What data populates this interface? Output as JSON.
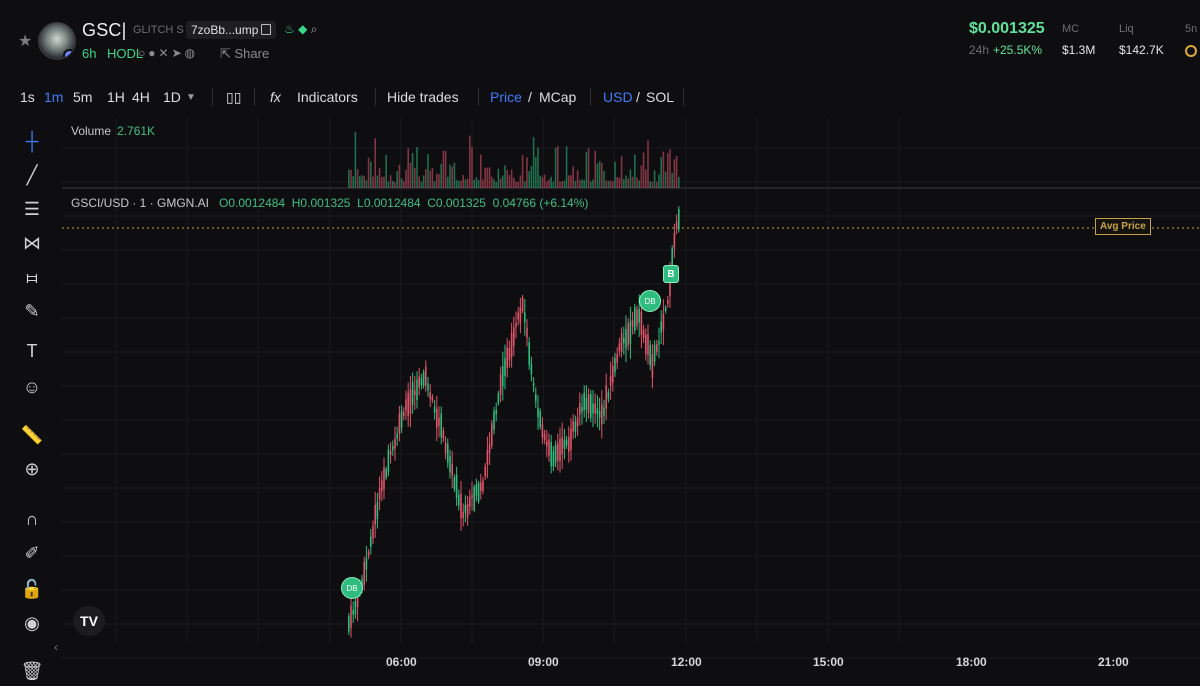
{
  "header": {
    "symbol": "GSC|",
    "name": "GLITCH S",
    "address": "7zoBb...ump",
    "age": "6h",
    "hodl": "HODL",
    "share": "Share",
    "price": "$0.001325",
    "change_label": "24h",
    "change": "+25.5K%",
    "mc_label": "MC",
    "mc_value": "$1.3M",
    "liq_label": "Liq",
    "liq_value": "$142.7K",
    "extra_label": "5n"
  },
  "toolbar": {
    "intervals": [
      "1s",
      "1m",
      "5m",
      "1H",
      "4H",
      "1D"
    ],
    "active_interval": "1m",
    "indicators": "Indicators",
    "hide_trades": "Hide trades",
    "price": "Price",
    "slash1": "/",
    "mcap": "MCap",
    "usd": "USD",
    "slash2": "/",
    "sol": "SOL"
  },
  "legend": {
    "volume_label": "Volume",
    "volume_value": "2.761K",
    "pair": "GSCI/USD · 1 · GMGN.AI",
    "o": "O0.0012484",
    "h": "H0.001325",
    "l": "L0.0012484",
    "c": "C0.001325",
    "chg": "0.04766 (+6.14%)"
  },
  "avg_price_label": "Avg Price",
  "markers": [
    "DB",
    "DB",
    "B"
  ],
  "time_axis": [
    "06:00",
    "09:00",
    "12:00",
    "15:00",
    "18:00",
    "21:00"
  ],
  "colors": {
    "up": "#2ebd7e",
    "down": "#e0546a",
    "accent": "#3f7bff",
    "avg": "#c9a34a"
  },
  "tools": [
    "crosshair-icon",
    "trendline-icon",
    "fib-icon",
    "pattern-icon",
    "projection-icon",
    "brush-icon",
    "text-icon",
    "emoji-icon",
    "ruler-icon",
    "zoom-icon",
    "magnet-icon",
    "lock-drawing-icon",
    "lock-icon",
    "eye-icon",
    "trash-icon"
  ]
}
